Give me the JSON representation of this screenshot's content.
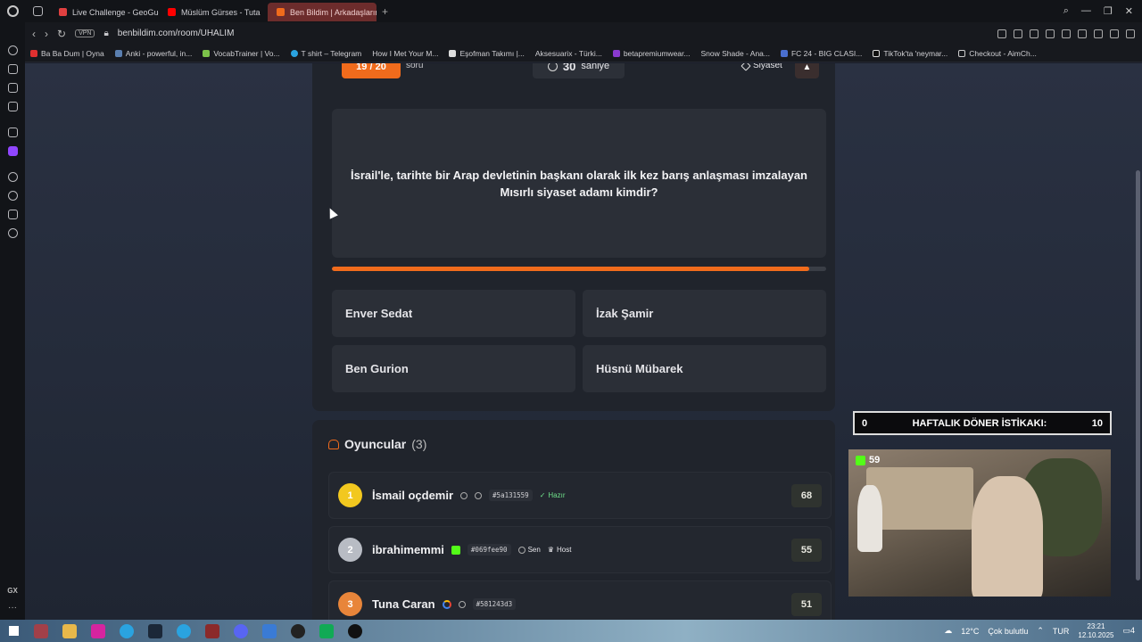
{
  "browser": {
    "tabs": [
      {
        "label": "Live Challenge - GeoGues",
        "color": "#e04040"
      },
      {
        "label": "Müslüm Gürses - Tuta",
        "color": "#ff0000"
      },
      {
        "label": "Ben Bildim | Arkadaşlarını",
        "color": "#f06b1c"
      }
    ],
    "url": "benbildim.com/room/UHALIM",
    "vpn_label": "VPN",
    "bookmarks": [
      "Ba Ba Dum | Oyna",
      "Anki - powerful, in...",
      "VocabTrainer | Vo...",
      "T shirt – Telegram",
      "How I Met Your M...",
      "Eşofman Takımı |...",
      "Aksesuarix - Türki...",
      "betapremiumwear...",
      "Snow Shade - Ana...",
      "FC 24 - BIG CLASI...",
      "TikTok'ta 'neymar...",
      "Checkout - AimCh..."
    ]
  },
  "game": {
    "question_counter": "19 / 20",
    "question_word": "soru",
    "timer_value": "30",
    "timer_unit": "saniye",
    "category": "Siyaset",
    "report_icon": "warning-icon",
    "question": "İsrail'le, tarihte bir Arap devletinin başkanı olarak ilk kez barış anlaşması imzalayan Mısırlı siyaset adamı kimdir?",
    "progress_fraction": 0.965,
    "accent_color": "#f06b1c",
    "answers": [
      "Enver Sedat",
      "İzak Şamir",
      "Ben Gurion",
      "Hüsnü Mübarek"
    ]
  },
  "players": {
    "title": "Oyuncular",
    "count": "(3)",
    "list": [
      {
        "rank": "1",
        "name": "İsmail oçdemir",
        "code": "#5a131559",
        "status": "Hazır",
        "score": "68",
        "rank_color": "#f2c81f"
      },
      {
        "rank": "2",
        "name": "ibrahimemmi",
        "code": "#069fee90",
        "tag1": "Sen",
        "tag2": "Host",
        "score": "55",
        "rank_color": "#b8bcc4"
      },
      {
        "rank": "3",
        "name": "Tuna Caran",
        "code": "#581243d3",
        "score": "51",
        "rank_color": "#e8853a"
      }
    ]
  },
  "overlay": {
    "weekly_left": "0",
    "weekly_label": "HAFTALIK DÖNER İSTİKAKI:",
    "weekly_right": "10",
    "viewers": "59"
  },
  "taskbar": {
    "weather_temp": "12°C",
    "weather_text": "Çok bulutlu",
    "lang": "TUR",
    "time": "23:21",
    "date": "12.10.2025",
    "notifications": "4"
  }
}
